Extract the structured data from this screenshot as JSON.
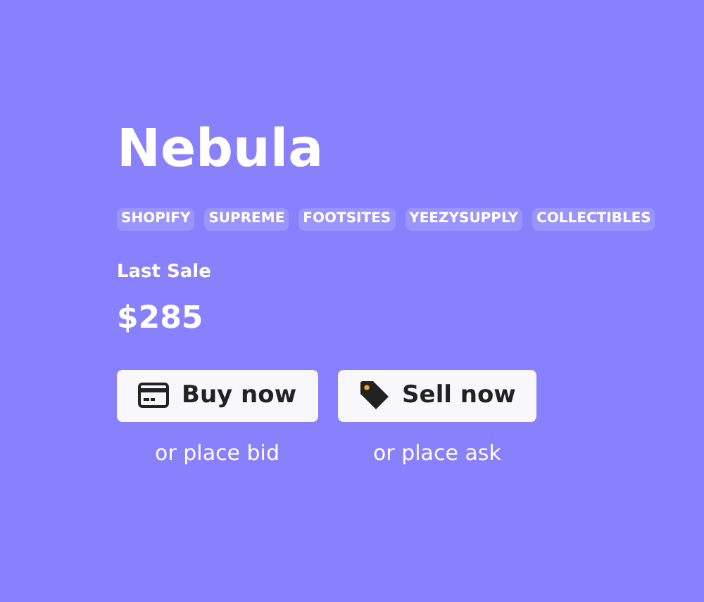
{
  "title": "Nebula",
  "tags": [
    "SHOPIFY",
    "SUPREME",
    "FOOTSITES",
    "YEEZYSUPPLY",
    "COLLECTIBLES"
  ],
  "last_sale": {
    "label": "Last Sale",
    "value": "$285"
  },
  "actions": [
    {
      "kind": "buy",
      "label": "Buy now",
      "subtext": "or place bid"
    },
    {
      "kind": "sell",
      "label": "Sell now",
      "subtext": "or place ask"
    }
  ]
}
